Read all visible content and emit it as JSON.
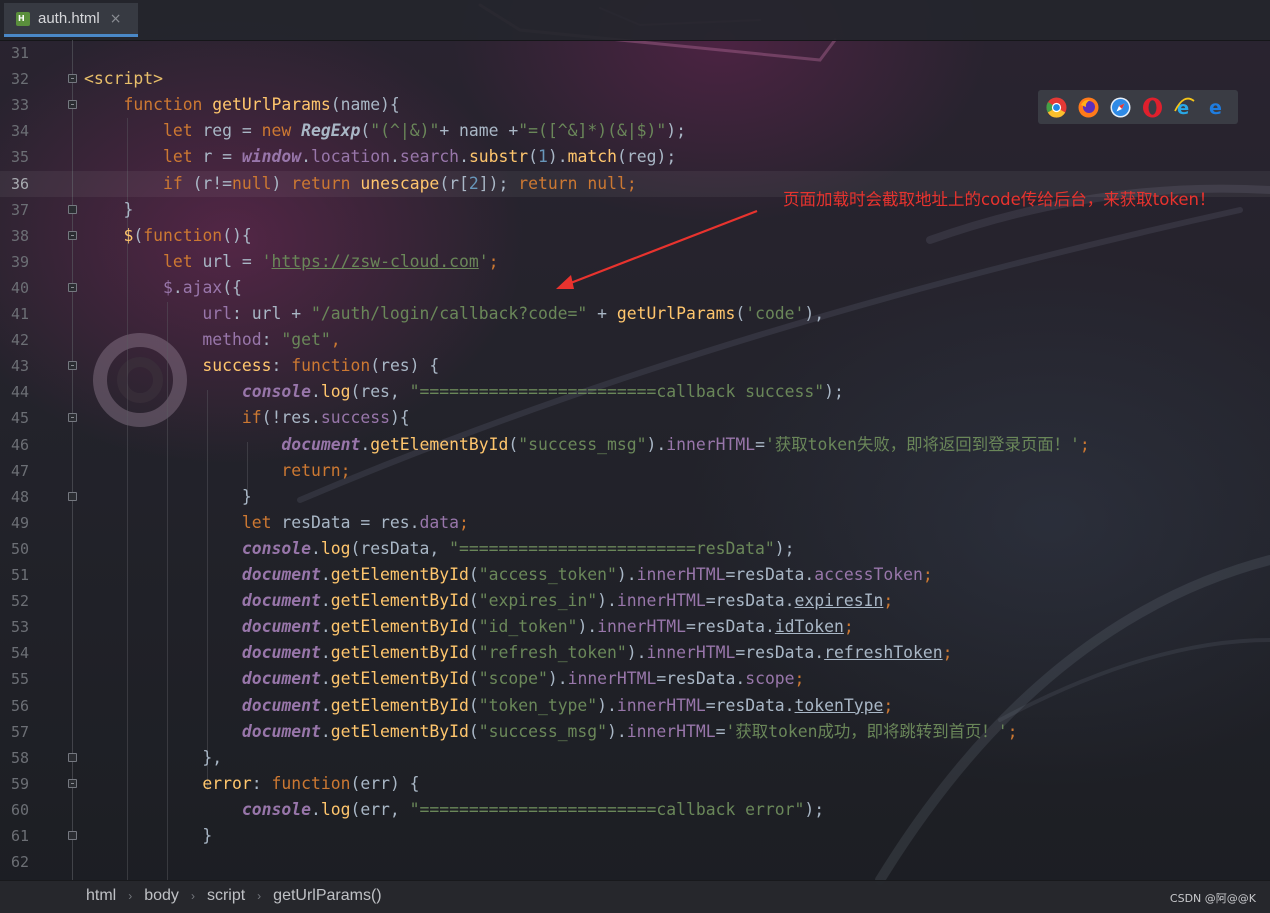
{
  "tab": {
    "label": "auth.html",
    "icon": "html-file-icon",
    "close": "×"
  },
  "annotation": "页面加载时会截取地址上的code传给后台，来获取token！",
  "browsers": [
    "chrome-icon",
    "firefox-icon",
    "safari-icon",
    "opera-icon",
    "internet-explorer-icon",
    "edge-icon"
  ],
  "breadcrumb": [
    "html",
    "body",
    "script",
    "getUrlParams()"
  ],
  "watermark": "CSDN @阿@@K",
  "current_line": 36,
  "lines": [
    {
      "n": 31,
      "t": []
    },
    {
      "n": 32,
      "fold": "open",
      "t": [
        [
          "tag",
          "<script>"
        ]
      ]
    },
    {
      "n": 33,
      "fold": "open",
      "t": [
        [
          "txt",
          "    "
        ],
        [
          "kw",
          "function "
        ],
        [
          "fn",
          "getUrlParams"
        ],
        [
          "txt",
          "(name){"
        ]
      ]
    },
    {
      "n": 34,
      "t": [
        [
          "txt",
          "        "
        ],
        [
          "kw",
          "let "
        ],
        [
          "txt",
          "reg = "
        ],
        [
          "kw",
          "new "
        ],
        [
          "cls",
          "RegExp"
        ],
        [
          "txt",
          "("
        ],
        [
          "str",
          "\"(^|&)\""
        ],
        [
          "txt",
          "+ name +"
        ],
        [
          "str",
          "\"=([^&]*)(&|$)\""
        ],
        [
          "txt",
          ");"
        ]
      ]
    },
    {
      "n": 35,
      "t": [
        [
          "txt",
          "        "
        ],
        [
          "kw",
          "let "
        ],
        [
          "txt",
          "r = "
        ],
        [
          "glob",
          "window"
        ],
        [
          "txt",
          "."
        ],
        [
          "prop",
          "location"
        ],
        [
          "txt",
          "."
        ],
        [
          "prop",
          "search"
        ],
        [
          "txt",
          "."
        ],
        [
          "meth",
          "substr"
        ],
        [
          "txt",
          "("
        ],
        [
          "num",
          "1"
        ],
        [
          "txt",
          ")."
        ],
        [
          "meth",
          "match"
        ],
        [
          "txt",
          "(reg);"
        ]
      ]
    },
    {
      "n": 36,
      "t": [
        [
          "txt",
          "        "
        ],
        [
          "kw",
          "if "
        ],
        [
          "txt",
          "(r!="
        ],
        [
          "kw",
          "null"
        ],
        [
          "txt",
          ") "
        ],
        [
          "kw",
          "return "
        ],
        [
          "meth",
          "unescape"
        ],
        [
          "txt",
          "(r["
        ],
        [
          "num",
          "2"
        ],
        [
          "txt",
          "]); "
        ],
        [
          "kw",
          "return null;"
        ]
      ]
    },
    {
      "n": 37,
      "fold": "close",
      "t": [
        [
          "txt",
          "    }"
        ]
      ]
    },
    {
      "n": 38,
      "fold": "open",
      "t": [
        [
          "txt",
          "    "
        ],
        [
          "fn",
          "$"
        ],
        [
          "txt",
          "("
        ],
        [
          "kw",
          "function"
        ],
        [
          "txt",
          "(){"
        ]
      ]
    },
    {
      "n": 39,
      "t": [
        [
          "txt",
          "        "
        ],
        [
          "kw",
          "let "
        ],
        [
          "txt",
          "url = "
        ],
        [
          "str",
          "'"
        ],
        [
          "lnk",
          "https://zsw-cloud.com"
        ],
        [
          "str",
          "'"
        ],
        [
          "kw",
          ";"
        ]
      ]
    },
    {
      "n": 40,
      "fold": "open",
      "t": [
        [
          "txt",
          "        "
        ],
        [
          "prop",
          "$"
        ],
        [
          "txt",
          "."
        ],
        [
          "prop",
          "ajax"
        ],
        [
          "txt",
          "({"
        ]
      ]
    },
    {
      "n": 41,
      "t": [
        [
          "txt",
          "            "
        ],
        [
          "prop",
          "url"
        ],
        [
          "txt",
          ": url + "
        ],
        [
          "str",
          "\"/auth/login/callback?code=\""
        ],
        [
          "txt",
          " + "
        ],
        [
          "meth",
          "getUrlParams"
        ],
        [
          "txt",
          "("
        ],
        [
          "str",
          "'code'"
        ],
        [
          "txt",
          "),"
        ]
      ]
    },
    {
      "n": 42,
      "t": [
        [
          "txt",
          "            "
        ],
        [
          "prop",
          "method"
        ],
        [
          "txt",
          ": "
        ],
        [
          "str",
          "\"get\""
        ],
        [
          "kw",
          ","
        ]
      ]
    },
    {
      "n": 43,
      "fold": "open",
      "t": [
        [
          "txt",
          "            "
        ],
        [
          "fn",
          "success"
        ],
        [
          "txt",
          ": "
        ],
        [
          "kw",
          "function"
        ],
        [
          "txt",
          "(res) {"
        ]
      ]
    },
    {
      "n": 44,
      "t": [
        [
          "txt",
          "                "
        ],
        [
          "glob",
          "console"
        ],
        [
          "txt",
          "."
        ],
        [
          "meth",
          "log"
        ],
        [
          "txt",
          "(res, "
        ],
        [
          "str",
          "\"========================callback success\""
        ],
        [
          "txt",
          ");"
        ]
      ]
    },
    {
      "n": 45,
      "fold": "open",
      "t": [
        [
          "txt",
          "                "
        ],
        [
          "kw",
          "if"
        ],
        [
          "txt",
          "(!res."
        ],
        [
          "prop",
          "success"
        ],
        [
          "txt",
          "){"
        ]
      ]
    },
    {
      "n": 46,
      "t": [
        [
          "txt",
          "                    "
        ],
        [
          "glob",
          "document"
        ],
        [
          "txt",
          "."
        ],
        [
          "meth",
          "getElementById"
        ],
        [
          "txt",
          "("
        ],
        [
          "str",
          "\"success_msg\""
        ],
        [
          "txt",
          ")."
        ],
        [
          "prop",
          "innerHTML"
        ],
        [
          "txt",
          "="
        ],
        [
          "str",
          "'获取token失败，即将返回到登录页面！'"
        ],
        [
          "kw",
          ";"
        ]
      ]
    },
    {
      "n": 47,
      "t": [
        [
          "txt",
          "                    "
        ],
        [
          "kw",
          "return;"
        ]
      ]
    },
    {
      "n": 48,
      "fold": "close",
      "t": [
        [
          "txt",
          "                }"
        ]
      ]
    },
    {
      "n": 49,
      "t": [
        [
          "txt",
          "                "
        ],
        [
          "kw",
          "let "
        ],
        [
          "txt",
          "resData = res."
        ],
        [
          "prop",
          "data"
        ],
        [
          "kw",
          ";"
        ]
      ]
    },
    {
      "n": 50,
      "t": [
        [
          "txt",
          "                "
        ],
        [
          "glob",
          "console"
        ],
        [
          "txt",
          "."
        ],
        [
          "meth",
          "log"
        ],
        [
          "txt",
          "(resData, "
        ],
        [
          "str",
          "\"========================resData\""
        ],
        [
          "txt",
          ");"
        ]
      ]
    },
    {
      "n": 51,
      "t": [
        [
          "txt",
          "                "
        ],
        [
          "glob",
          "document"
        ],
        [
          "txt",
          "."
        ],
        [
          "meth",
          "getElementById"
        ],
        [
          "txt",
          "("
        ],
        [
          "str",
          "\"access_token\""
        ],
        [
          "txt",
          ")."
        ],
        [
          "prop",
          "innerHTML"
        ],
        [
          "txt",
          "=resData."
        ],
        [
          "prop",
          "accessToken"
        ],
        [
          "kw",
          ";"
        ]
      ]
    },
    {
      "n": 52,
      "t": [
        [
          "txt",
          "                "
        ],
        [
          "glob",
          "document"
        ],
        [
          "txt",
          "."
        ],
        [
          "meth",
          "getElementById"
        ],
        [
          "txt",
          "("
        ],
        [
          "str",
          "\"expires_in\""
        ],
        [
          "txt",
          ")."
        ],
        [
          "prop",
          "innerHTML"
        ],
        [
          "txt",
          "=resData."
        ],
        [
          "wavy",
          "expiresIn"
        ],
        [
          "kw",
          ";"
        ]
      ]
    },
    {
      "n": 53,
      "t": [
        [
          "txt",
          "                "
        ],
        [
          "glob",
          "document"
        ],
        [
          "txt",
          "."
        ],
        [
          "meth",
          "getElementById"
        ],
        [
          "txt",
          "("
        ],
        [
          "str",
          "\"id_token\""
        ],
        [
          "txt",
          ")."
        ],
        [
          "prop",
          "innerHTML"
        ],
        [
          "txt",
          "=resData."
        ],
        [
          "wavy",
          "idToken"
        ],
        [
          "kw",
          ";"
        ]
      ]
    },
    {
      "n": 54,
      "t": [
        [
          "txt",
          "                "
        ],
        [
          "glob",
          "document"
        ],
        [
          "txt",
          "."
        ],
        [
          "meth",
          "getElementById"
        ],
        [
          "txt",
          "("
        ],
        [
          "str",
          "\"refresh_token\""
        ],
        [
          "txt",
          ")."
        ],
        [
          "prop",
          "innerHTML"
        ],
        [
          "txt",
          "=resData."
        ],
        [
          "wavy",
          "refreshToken"
        ],
        [
          "kw",
          ";"
        ]
      ]
    },
    {
      "n": 55,
      "t": [
        [
          "txt",
          "                "
        ],
        [
          "glob",
          "document"
        ],
        [
          "txt",
          "."
        ],
        [
          "meth",
          "getElementById"
        ],
        [
          "txt",
          "("
        ],
        [
          "str",
          "\"scope\""
        ],
        [
          "txt",
          ")."
        ],
        [
          "prop",
          "innerHTML"
        ],
        [
          "txt",
          "=resData."
        ],
        [
          "prop",
          "scope"
        ],
        [
          "kw",
          ";"
        ]
      ]
    },
    {
      "n": 56,
      "t": [
        [
          "txt",
          "                "
        ],
        [
          "glob",
          "document"
        ],
        [
          "txt",
          "."
        ],
        [
          "meth",
          "getElementById"
        ],
        [
          "txt",
          "("
        ],
        [
          "str",
          "\"token_type\""
        ],
        [
          "txt",
          ")."
        ],
        [
          "prop",
          "innerHTML"
        ],
        [
          "txt",
          "=resData."
        ],
        [
          "wavy",
          "tokenType"
        ],
        [
          "kw",
          ";"
        ]
      ]
    },
    {
      "n": 57,
      "t": [
        [
          "txt",
          "                "
        ],
        [
          "glob",
          "document"
        ],
        [
          "txt",
          "."
        ],
        [
          "meth",
          "getElementById"
        ],
        [
          "txt",
          "("
        ],
        [
          "str",
          "\"success_msg\""
        ],
        [
          "txt",
          ")."
        ],
        [
          "prop",
          "innerHTML"
        ],
        [
          "txt",
          "="
        ],
        [
          "str",
          "'获取token成功，即将跳转到首页！'"
        ],
        [
          "kw",
          ";"
        ]
      ]
    },
    {
      "n": 58,
      "fold": "close",
      "t": [
        [
          "txt",
          "            },"
        ]
      ]
    },
    {
      "n": 59,
      "fold": "open",
      "t": [
        [
          "txt",
          "            "
        ],
        [
          "fn",
          "error"
        ],
        [
          "txt",
          ": "
        ],
        [
          "kw",
          "function"
        ],
        [
          "txt",
          "(err) {"
        ]
      ]
    },
    {
      "n": 60,
      "t": [
        [
          "txt",
          "                "
        ],
        [
          "glob",
          "console"
        ],
        [
          "txt",
          "."
        ],
        [
          "meth",
          "log"
        ],
        [
          "txt",
          "(err, "
        ],
        [
          "str",
          "\"========================callback error\""
        ],
        [
          "txt",
          ");"
        ]
      ]
    },
    {
      "n": 61,
      "fold": "close",
      "t": [
        [
          "txt",
          "            }"
        ]
      ]
    },
    {
      "n": 62,
      "t": []
    }
  ]
}
